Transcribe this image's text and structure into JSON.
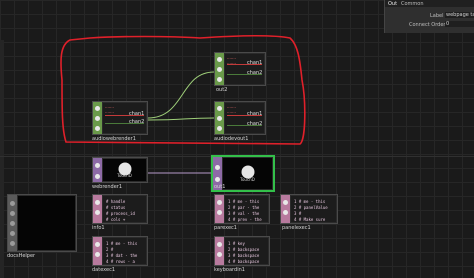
{
  "panel": {
    "tabs": [
      "Out",
      "Common"
    ],
    "label_name": "Label",
    "label_value": "webpage ta",
    "connect_order_name": "Connect Order",
    "connect_order_value": "0"
  },
  "nodes": {
    "out2": {
      "name": "out2",
      "ch1": "chan1",
      "ch2": "chan2"
    },
    "audiowebrender1": {
      "name": "audiowebrender1",
      "ch1": "chan1",
      "ch2": "chan2"
    },
    "audiodevout1": {
      "name": "audiodevout1",
      "ch1": "chan1",
      "ch2": "chan2"
    },
    "out1": {
      "name": "out1",
      "logo": "TouchD"
    },
    "webrender1": {
      "name": "webrender1",
      "logo": "TouchD"
    },
    "docsHelper": {
      "name": "docsHelper"
    },
    "info1": {
      "name": "info1",
      "text": "# handle\n# status\n# process_id\n# cols +"
    },
    "parexec1": {
      "name": "parexec1",
      "text": "1 # me - this\n2 # par - the\n3 # val - the\n4 # prev - the"
    },
    "panelexec1": {
      "name": "panelexec1",
      "text": "1 # me - this\n2 # panelValue\n3 # \n4 # Make sure"
    },
    "datexec1": {
      "name": "datexec1",
      "text": "1 # me - this\n2 # \n3 # dat - the\n4 # rows - a"
    },
    "keyboardin1": {
      "name": "keyboardin1",
      "text": "1 # key\n2 # backspace\n3 # backspace\n4 # backspace"
    }
  },
  "colors": {
    "chop": "#6a9a4a",
    "top": "#8d6aa6",
    "dat": "#b87a9e",
    "selection": "#33c04a",
    "annotation": "#e0202a"
  }
}
